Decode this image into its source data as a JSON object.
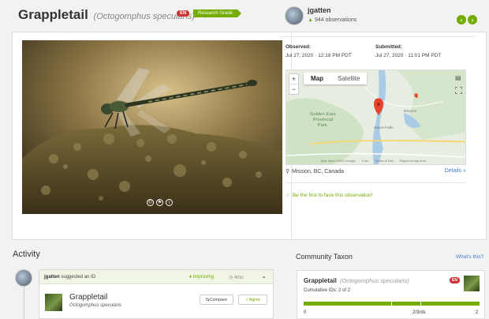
{
  "header": {
    "common_name": "Grappletail",
    "scientific_name": "(Octogomphus specularis)",
    "status_badge": "EN",
    "quality_badge": "Research Grade"
  },
  "observer": {
    "name": "jgatten",
    "observations": "944 observations"
  },
  "dates": {
    "observed_label": "Observed:",
    "observed_value": "Jul 27, 2020 · 12:18 PM PDT",
    "submitted_label": "Submitted:",
    "submitted_value": "Jul 27, 2020 · 11:01 PM PDT"
  },
  "map": {
    "tab_map": "Map",
    "tab_satellite": "Satellite",
    "zoom_in": "+",
    "zoom_out": "−",
    "place_label_1": "Golden Ears",
    "place_label_2": "Provincial",
    "place_label_3": "Park",
    "place_label_4": "Stave Falls",
    "place_label_5": "Mission",
    "footer_data": "Map data ©2020 Google",
    "footer_scale": "5 km",
    "footer_terms": "Terms of Use",
    "footer_report": "Report a map error"
  },
  "location": {
    "place": "Mission, BC, Canada",
    "details_link": "Details »"
  },
  "fave_text": "Be the first to fave this observation!",
  "activity": {
    "title": "Activity",
    "suggester": "jgatten",
    "suggested_text": "suggested an ID",
    "improving": "Improving",
    "age": "4mo",
    "taxon_name": "Grappletail",
    "taxon_sci": "Octogomphus specularis",
    "compare_btn": "Compare",
    "agree_btn": "Agree"
  },
  "community_taxon": {
    "title": "Community Taxon",
    "whats_this": "What's this?",
    "name": "Grappletail",
    "sci": "(Octogomphus specularis)",
    "badge": "EN",
    "cumulative": "Cumulative IDs: 2 of 2",
    "scale_min": "0",
    "scale_mid": "2/3rds",
    "scale_max": "2",
    "agreement_fraction": 1.0
  },
  "colors": {
    "brand_green": "#74ac00",
    "endangered_red": "#cc3333",
    "link_blue": "#3f7ccd"
  }
}
